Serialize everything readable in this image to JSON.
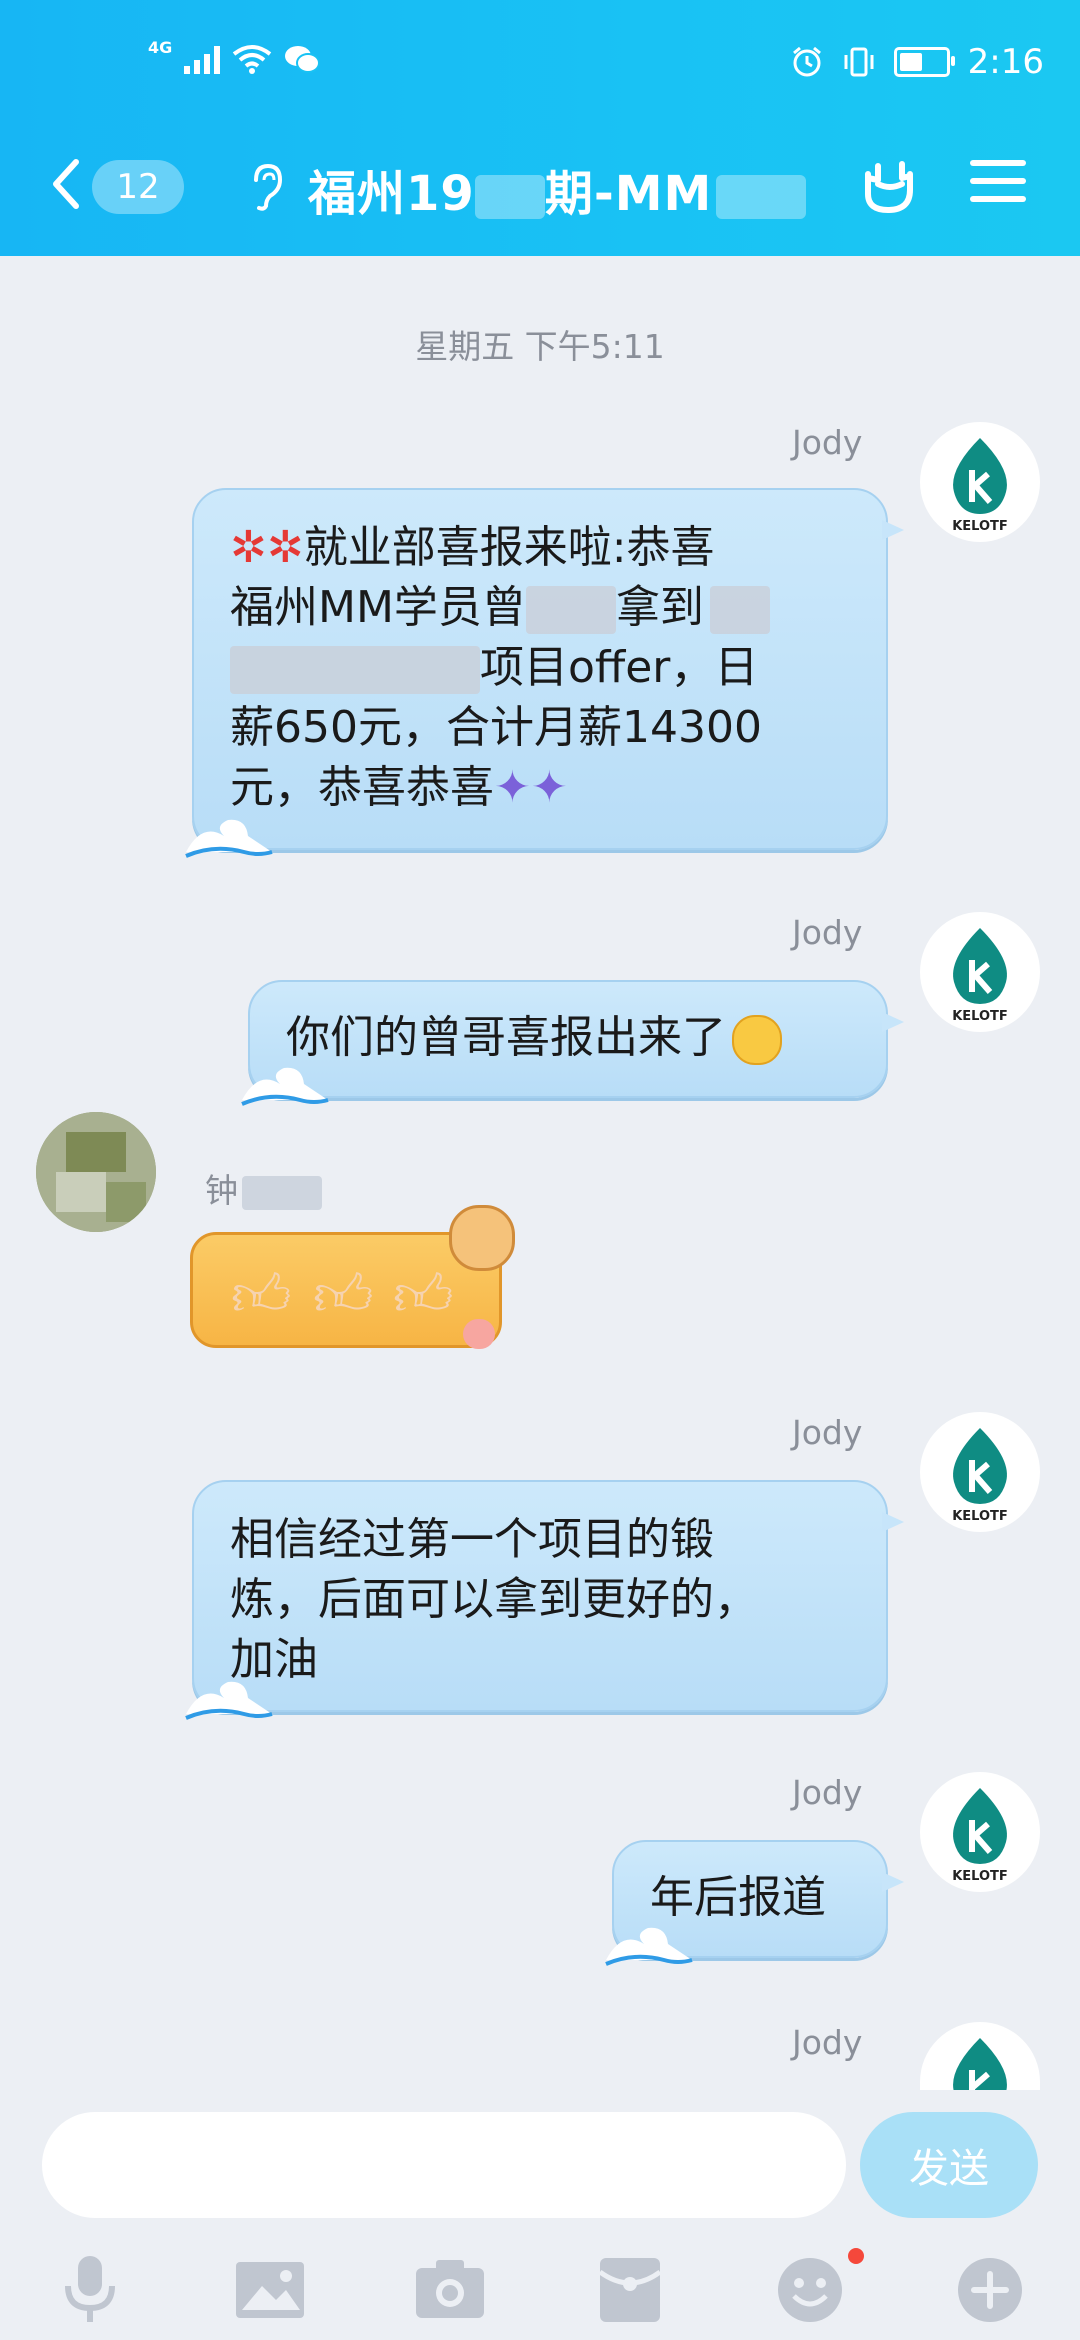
{
  "status_bar": {
    "network": "4G",
    "time": "2:16"
  },
  "header": {
    "unread_count": "12",
    "title_prefix": "福州19",
    "title_middle": "期-MM"
  },
  "chat": {
    "timestamp": "星期五 下午5:11",
    "messages": [
      {
        "sender": "Jody",
        "side": "right",
        "lines": [
          "就业部喜报来啦:恭喜",
          "福州MM学员曾",
          "拿到",
          "项目offer，日",
          "薪650元，合计月薪14300",
          "元，恭喜恭喜"
        ]
      },
      {
        "sender": "Jody",
        "side": "right",
        "text": "你们的曾哥喜报出来了"
      },
      {
        "sender": "钟",
        "side": "left",
        "sticker": "thumbs-up-sticker"
      },
      {
        "sender": "Jody",
        "side": "right",
        "lines": [
          "相信经过第一个项目的锻",
          "炼，后面可以拿到更好的，",
          "加油"
        ]
      },
      {
        "sender": "Jody",
        "side": "right",
        "text": "年后报道"
      },
      {
        "sender": "Jody",
        "side": "right"
      }
    ],
    "avatar_label": "KELOTF"
  },
  "input": {
    "placeholder": "",
    "send_label": "发送"
  },
  "toolbar": {
    "icons": [
      "microphone-icon",
      "image-icon",
      "camera-icon",
      "red-packet-icon",
      "emoji-icon",
      "plus-icon"
    ]
  },
  "colors": {
    "header": "#19C2F4",
    "bubble_right": "#C7E5FA",
    "bubble_left": "#F7B545",
    "background": "#ECEFF4",
    "badge_dot": "#F5483B"
  }
}
